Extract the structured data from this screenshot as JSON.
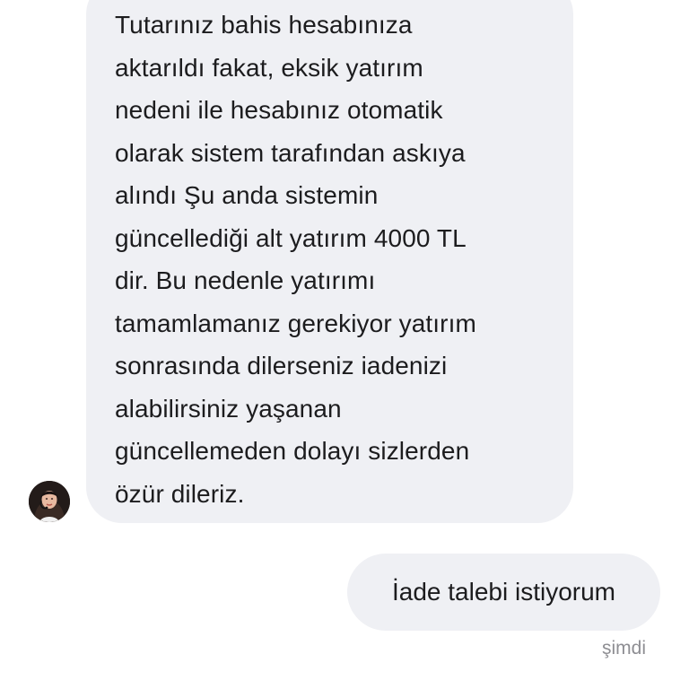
{
  "conversation": {
    "incoming": {
      "lines": [
        "Tutarınız bahis hesabınıza",
        "aktarıldı fakat, eksik yatırım",
        "nedeni ile hesabınız otomatik",
        "olarak sistem tarafından askıya",
        "alındı Şu anda sistemin",
        "güncellediği alt yatırım 4000 TL",
        "dir. Bu nedenle yatırımı",
        "tamamlamanız gerekiyor yatırım",
        "sonrasında dilerseniz iadenizi",
        "alabilirsiniz yaşanan",
        "güncellemeden dolayı sizlerden",
        "özür dileriz."
      ],
      "avatar_icon": "agent-avatar-photo"
    },
    "outgoing": {
      "text": "İade talebi istiyorum",
      "timestamp": "şimdi"
    }
  },
  "colors": {
    "bubble_background": "#eff0f4",
    "text": "#1c1c1e",
    "timestamp": "#8e8e93",
    "page_background": "#ffffff"
  }
}
